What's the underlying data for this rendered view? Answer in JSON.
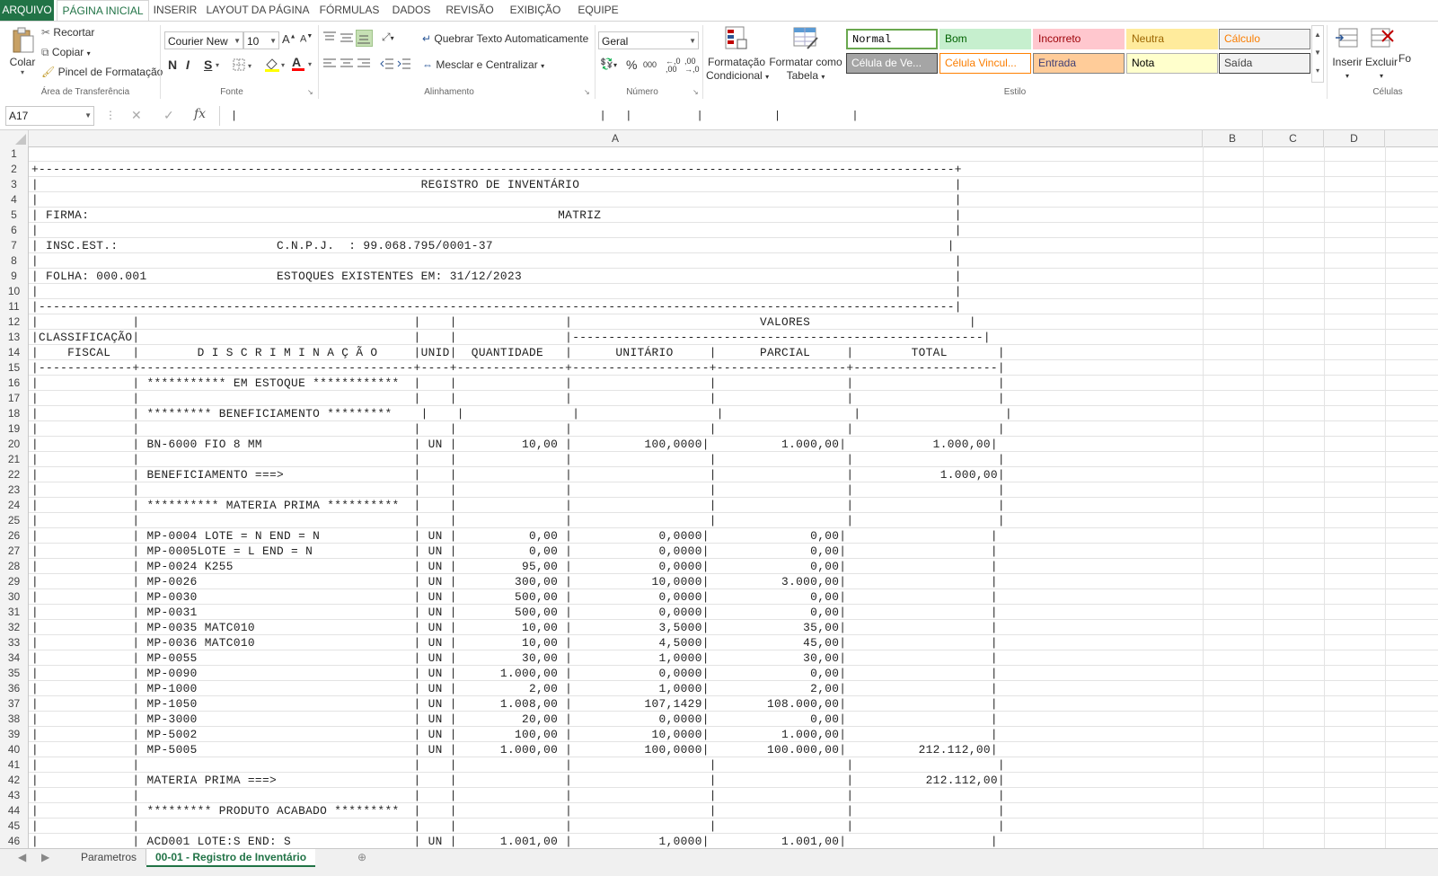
{
  "ribbon_tabs": [
    "ARQUIVO",
    "PÁGINA INICIAL",
    "INSERIR",
    "LAYOUT DA PÁGINA",
    "FÓRMULAS",
    "DADOS",
    "REVISÃO",
    "EXIBIÇÃO",
    "EQUIPE"
  ],
  "clipboard": {
    "paste": "Colar",
    "cut": "Recortar",
    "copy": "Copiar",
    "format_painter": "Pincel de Formatação",
    "group": "Área de Transferência"
  },
  "font": {
    "name": "Courier New",
    "size": "10",
    "bold": "N",
    "italic": "I",
    "underline": "S",
    "group": "Fonte"
  },
  "alignment": {
    "wrap": "Quebrar Texto Automaticamente",
    "merge": "Mesclar e Centralizar",
    "group": "Alinhamento"
  },
  "number": {
    "format": "Geral",
    "group": "Número"
  },
  "styles_group": {
    "cond_format_1": "Formatação",
    "cond_format_2": "Condicional",
    "format_table_1": "Formatar como",
    "format_table_2": "Tabela",
    "group": "Estilo"
  },
  "cell_styles": [
    {
      "label": "Normal",
      "bg": "#ffffff",
      "fg": "#000000",
      "border": "#6aa84f",
      "mono": true
    },
    {
      "label": "Bom",
      "bg": "#c6efce",
      "fg": "#006100",
      "border": "#c6efce"
    },
    {
      "label": "Incorreto",
      "bg": "#ffc7ce",
      "fg": "#9c0006",
      "border": "#ffc7ce"
    },
    {
      "label": "Neutra",
      "bg": "#ffeb9c",
      "fg": "#9c6500",
      "border": "#ffeb9c"
    },
    {
      "label": "Cálculo",
      "bg": "#f2f2f2",
      "fg": "#fa7d00",
      "border": "#7f7f7f"
    },
    {
      "label": "Célula de Ve...",
      "bg": "#a5a5a5",
      "fg": "#ffffff",
      "border": "#3f3f3f"
    },
    {
      "label": "Célula Vincul...",
      "bg": "#ffffff",
      "fg": "#fa7d00",
      "border": "#ff8001"
    },
    {
      "label": "Entrada",
      "bg": "#ffcc99",
      "fg": "#3f3f76",
      "border": "#7f7f7f"
    },
    {
      "label": "Nota",
      "bg": "#ffffcc",
      "fg": "#000000",
      "border": "#b2b2b2"
    },
    {
      "label": "Saída",
      "bg": "#f2f2f2",
      "fg": "#3f3f3f",
      "border": "#3f3f3f"
    }
  ],
  "cells_group": {
    "insert": "Inserir",
    "delete": "Excluir",
    "format_partial": "Fo",
    "group": "Células"
  },
  "formula_bar": {
    "name_box": "A17",
    "fx": "fx",
    "content": "|                                                        |   |          |           |           |"
  },
  "columns": [
    "A",
    "B",
    "C",
    "D"
  ],
  "rows": [
    {
      "n": "1",
      "t": ""
    },
    {
      "n": "2",
      "t": "+-------------------------------------------------------------------------------------------------------------------------------+"
    },
    {
      "n": "3",
      "t": "|                                                     REGISTRO DE INVENTÁRIO                                                    |"
    },
    {
      "n": "4",
      "t": "|                                                                                                                               |"
    },
    {
      "n": "5",
      "t": "| FIRMA:                                                                 MATRIZ                                                 |"
    },
    {
      "n": "6",
      "t": "|                                                                                                                               |"
    },
    {
      "n": "7",
      "t": "| INSC.EST.:                      C.N.P.J.  : 99.068.795/0001-37                                                               |"
    },
    {
      "n": "8",
      "t": "|                                                                                                                               |"
    },
    {
      "n": "9",
      "t": "| FOLHA: 000.001                  ESTOQUES EXISTENTES EM: 31/12/2023                                                            |"
    },
    {
      "n": "10",
      "t": "|                                                                                                                               |"
    },
    {
      "n": "11",
      "t": "|-------------------------------------------------------------------------------------------------------------------------------|"
    },
    {
      "n": "12",
      "t": "|             |                                      |    |               |                          VALORES                      |"
    },
    {
      "n": "13",
      "t": "|CLASSIFICAÇÃO|                                      |    |               |---------------------------------------------------------|"
    },
    {
      "n": "14",
      "t": "|    FISCAL   |        D I S C R I M I N A Ç Ã O     |UNID|  QUANTIDADE   |      UNITÁRIO     |      PARCIAL     |        TOTAL       |"
    },
    {
      "n": "15",
      "t": "|-------------+--------------------------------------+----+---------------+-------------------+------------------+--------------------|"
    },
    {
      "n": "16",
      "t": "|             | *********** EM ESTOQUE ************  |    |               |                   |                  |                    |"
    },
    {
      "n": "17",
      "t": "|             |                                      |    |               |                   |                  |                    |"
    },
    {
      "n": "18",
      "t": "|             | ********* BENEFICIAMENTO *********    |    |               |                   |                  |                    |"
    },
    {
      "n": "19",
      "t": "|             |                                      |    |               |                   |                  |                    |"
    },
    {
      "n": "20",
      "t": "|             | BN-6000 FIO 8 MM                     | UN |         10,00 |          100,0000|          1.000,00|            1.000,00|"
    },
    {
      "n": "21",
      "t": "|             |                                      |    |               |                   |                  |                    |"
    },
    {
      "n": "22",
      "t": "|             | BENEFICIAMENTO ===>                  |    |               |                   |                  |            1.000,00|"
    },
    {
      "n": "23",
      "t": "|             |                                      |    |               |                   |                  |                    |"
    },
    {
      "n": "24",
      "t": "|             | ********** MATERIA PRIMA **********  |    |               |                   |                  |                    |"
    },
    {
      "n": "25",
      "t": "|             |                                      |    |               |                   |                  |                    |"
    },
    {
      "n": "26",
      "t": "|             | MP-0004 LOTE = N END = N             | UN |          0,00 |            0,0000|              0,00|                    |"
    },
    {
      "n": "27",
      "t": "|             | MP-0005LOTE = L END = N              | UN |          0,00 |            0,0000|              0,00|                    |"
    },
    {
      "n": "28",
      "t": "|             | MP-0024 K255                         | UN |         95,00 |            0,0000|              0,00|                    |"
    },
    {
      "n": "29",
      "t": "|             | MP-0026                              | UN |        300,00 |           10,0000|          3.000,00|                    |"
    },
    {
      "n": "30",
      "t": "|             | MP-0030                              | UN |        500,00 |            0,0000|              0,00|                    |"
    },
    {
      "n": "31",
      "t": "|             | MP-0031                              | UN |        500,00 |            0,0000|              0,00|                    |"
    },
    {
      "n": "32",
      "t": "|             | MP-0035 MATC010                      | UN |         10,00 |            3,5000|             35,00|                    |"
    },
    {
      "n": "33",
      "t": "|             | MP-0036 MATC010                      | UN |         10,00 |            4,5000|             45,00|                    |"
    },
    {
      "n": "34",
      "t": "|             | MP-0055                              | UN |         30,00 |            1,0000|             30,00|                    |"
    },
    {
      "n": "35",
      "t": "|             | MP-0090                              | UN |      1.000,00 |            0,0000|              0,00|                    |"
    },
    {
      "n": "36",
      "t": "|             | MP-1000                              | UN |          2,00 |            1,0000|              2,00|                    |"
    },
    {
      "n": "37",
      "t": "|             | MP-1050                              | UN |      1.008,00 |          107,1429|        108.000,00|                    |"
    },
    {
      "n": "38",
      "t": "|             | MP-3000                              | UN |         20,00 |            0,0000|              0,00|                    |"
    },
    {
      "n": "39",
      "t": "|             | MP-5002                              | UN |        100,00 |           10,0000|          1.000,00|                    |"
    },
    {
      "n": "40",
      "t": "|             | MP-5005                              | UN |      1.000,00 |          100,0000|        100.000,00|          212.112,00|"
    },
    {
      "n": "41",
      "t": "|             |                                      |    |               |                   |                  |                    |"
    },
    {
      "n": "42",
      "t": "|             | MATERIA PRIMA ===>                   |    |               |                   |                  |          212.112,00|"
    },
    {
      "n": "43",
      "t": "|             |                                      |    |               |                   |                  |                    |"
    },
    {
      "n": "44",
      "t": "|             | ********* PRODUTO ACABADO *********  |    |               |                   |                  |                    |"
    },
    {
      "n": "45",
      "t": "|             |                                      |    |               |                   |                  |                    |"
    },
    {
      "n": "46",
      "t": "|             | ACD001 LOTE:S END: S                 | UN |      1.001,00 |            1,0000|          1.001,00|                    |"
    }
  ],
  "sheet_tabs": {
    "first": "Parametros",
    "second": "00-01 - Registro de Inventário"
  }
}
